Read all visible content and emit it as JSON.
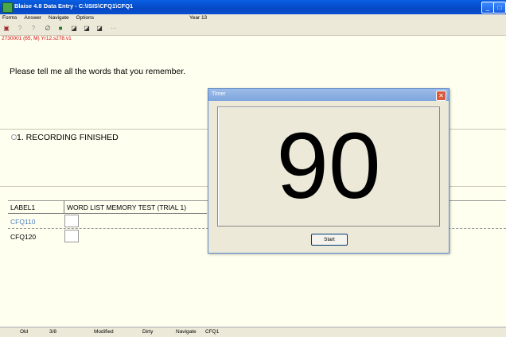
{
  "window": {
    "title": "Blaise 4.8 Data Entry - C:\\ISIS\\CFQ1\\CFQ1",
    "controls": [
      "minimize",
      "maximize",
      "close"
    ]
  },
  "menu": {
    "items": [
      "Forms",
      "Answer",
      "Navigate",
      "Options"
    ],
    "context": "Year 13"
  },
  "toolbar": {
    "icons": [
      "save-icon",
      "help-icon",
      "help-alt-icon",
      "attach-icon",
      "document-icon",
      "window-icon",
      "window2-icon",
      "window3-icon",
      "more-icon"
    ],
    "more_glyph": "···"
  },
  "form": {
    "id_line": "2730001 (65, M) Yr12.s278.v1",
    "question": "Please tell me all the words that you remember.",
    "option": "1. RECORDING FINISHED"
  },
  "table": {
    "header": [
      "LABEL1",
      "WORD LIST MEMORY TEST (TRIAL 1)"
    ],
    "rows": [
      {
        "name": "CFQ110",
        "value": ""
      },
      {
        "name": "CFQ120",
        "value": ""
      }
    ]
  },
  "status": {
    "cells": [
      "Old",
      "3/8",
      "Modified",
      "Dirty",
      "Navigate",
      "CFQ1"
    ]
  },
  "timer_dialog": {
    "title": "Timer",
    "count": "90",
    "button": "Start"
  },
  "colors": {
    "titlebar": "#0548c4",
    "form_bg": "#fffff0",
    "id_line": "#d00000",
    "active_field": "#5080c0"
  }
}
